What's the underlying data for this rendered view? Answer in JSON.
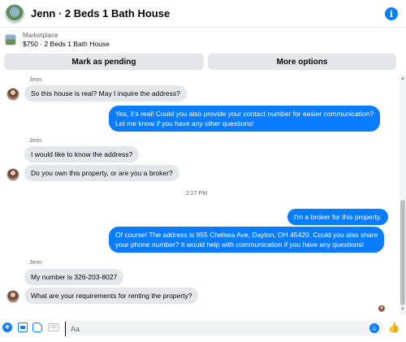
{
  "header": {
    "title": "Jenn · 2 Beds 1 Bath House",
    "info_icon": "i"
  },
  "marketplace": {
    "label": "Marketplace",
    "item": "$750 · 2 Beds 1 Bath House"
  },
  "actions": {
    "pending_label": "Mark as pending",
    "more_label": "More options"
  },
  "conversation": {
    "sender_name": "Jenn",
    "messages": [
      {
        "from": "them",
        "text": "So this house is real? May I inquire the address?"
      },
      {
        "from": "me",
        "lines": [
          "Yes, it's real!  Could you also provide your contact number for easier communication?",
          "Let me know if you have any other questions!"
        ]
      },
      {
        "from": "them",
        "text": "I would like to know the address?"
      },
      {
        "from": "them",
        "text": "Do you own this property, or are you a broker?"
      },
      {
        "from": "me",
        "text": "I'm a broker for this property."
      },
      {
        "from": "me",
        "lines": [
          "Of course! The address is 955 Chelsea Ave, Dayton, OH 45420. Could you also share",
          "your phone number? It would help with communication if you have any questions!"
        ]
      },
      {
        "from": "them",
        "text": "My number is 326-203-8027"
      },
      {
        "from": "them",
        "text": "What are your requirements for renting the property?"
      }
    ],
    "timestamp": "2:27 PM"
  },
  "composer": {
    "placeholder": "Aa",
    "gif_label": "GIF",
    "plus_icon": "+"
  },
  "colors": {
    "accent": "#0a7cff",
    "incoming_bubble": "#e4e6eb"
  },
  "icons": [
    "info-icon",
    "plus-icon",
    "photo-icon",
    "sticker-icon",
    "gif-icon",
    "emoji-icon",
    "like-icon"
  ]
}
